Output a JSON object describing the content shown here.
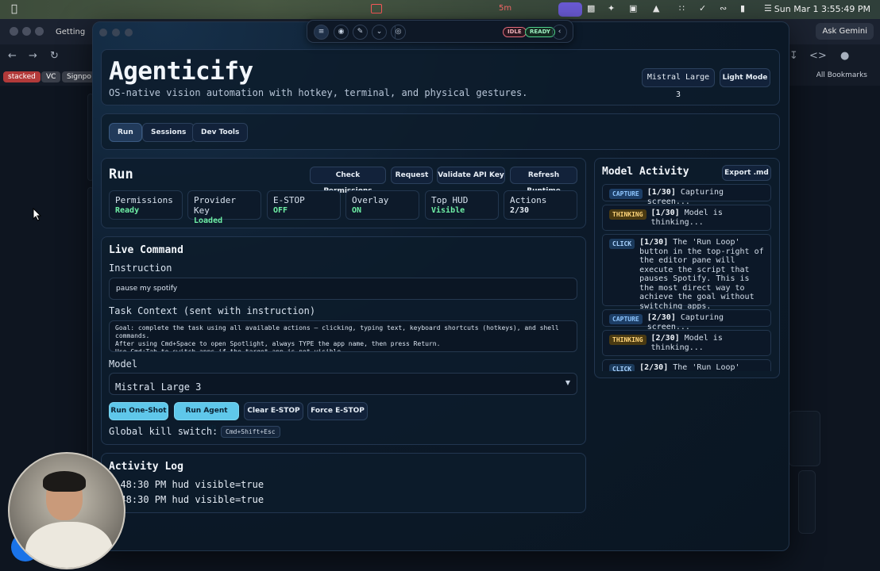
{
  "menubar": {
    "timer": "5m",
    "clock": "Sun Mar 1  3:55:49 PM"
  },
  "browser": {
    "tab_title": "Getting",
    "ask_label": "Ask Gemini",
    "bookmarks": [
      {
        "label": "stacked",
        "color": "#b23a3a"
      },
      {
        "label": "VC",
        "color": "#3a3f4a"
      },
      {
        "label": "Signpo",
        "color": "#3a3f4a"
      }
    ],
    "all_bookmarks": "All Bookmarks"
  },
  "hud": {
    "idle_label": "IDLE",
    "ready_label": "READY"
  },
  "header": {
    "title": "Agenticify",
    "subtitle": "OS-native vision automation with hotkey, terminal, and physical gestures.",
    "model_badge": "Mistral Large 3",
    "light_mode_label": "Light Mode"
  },
  "tabs": [
    {
      "label": "Run",
      "active": true
    },
    {
      "label": "Sessions",
      "active": false
    },
    {
      "label": "Dev Tools",
      "active": false
    }
  ],
  "run": {
    "heading": "Run",
    "buttons": {
      "check_permissions": "Check Permissions",
      "request": "Request",
      "validate_api_key": "Validate API Key",
      "refresh_runtime": "Refresh Runtime"
    },
    "stats": [
      {
        "label": "Permissions",
        "value": "Ready",
        "green": true
      },
      {
        "label": "Provider Key",
        "value": "Loaded",
        "green": true
      },
      {
        "label": "E-STOP",
        "value": "OFF",
        "green": true
      },
      {
        "label": "Overlay",
        "value": "ON",
        "green": true
      },
      {
        "label": "Top HUD",
        "value": "Visible",
        "green": true
      },
      {
        "label": "Actions",
        "value": "2/30",
        "green": false
      }
    ]
  },
  "live_command": {
    "heading": "Live Command",
    "instruction_label": "Instruction",
    "instruction_value": "pause my spotify",
    "context_label": "Task Context (sent with instruction)",
    "context_value": "Goal: complete the task using all available actions — clicking, typing text, keyboard shortcuts (hotkeys), and shell commands.\nAfter using Cmd+Space to open Spotlight, always TYPE the app name, then press Return.\nUse Cmd+Tab to switch apps if the target app is not visible.",
    "model_label": "Model",
    "model_value": "Mistral Large 3",
    "buttons": {
      "run_one_shot": "Run One-Shot",
      "run_agent_loop": "Run Agent Loop",
      "clear_estop": "Clear E-STOP",
      "force_estop": "Force E-STOP"
    },
    "kill_switch_label": "Global kill switch:",
    "kill_switch_key": "Cmd+Shift+Esc"
  },
  "activity_log": {
    "heading": "Activity Log",
    "entries": [
      "3:48:30 PM hud visible=true",
      "3:48:30 PM hud visible=true"
    ]
  },
  "model_activity": {
    "heading": "Model Activity",
    "export_label": "Export .md",
    "items": [
      {
        "tag": "CAPTURE",
        "step": "[1/30]",
        "text": "Capturing screen..."
      },
      {
        "tag": "THINKING",
        "step": "[1/30]",
        "text": "Model is thinking..."
      },
      {
        "tag": "CLICK",
        "step": "[1/30]",
        "text": "The 'Run Loop' button in the top-right of the editor pane will execute the script that pauses Spotify. This is the most direct way to achieve the goal without switching apps."
      },
      {
        "tag": "CAPTURE",
        "step": "[2/30]",
        "text": "Capturing screen..."
      },
      {
        "tag": "THINKING",
        "step": "[2/30]",
        "text": "Model is thinking..."
      },
      {
        "tag": "CLICK",
        "step": "[2/30]",
        "text": "The 'Run Loop' button"
      }
    ]
  }
}
